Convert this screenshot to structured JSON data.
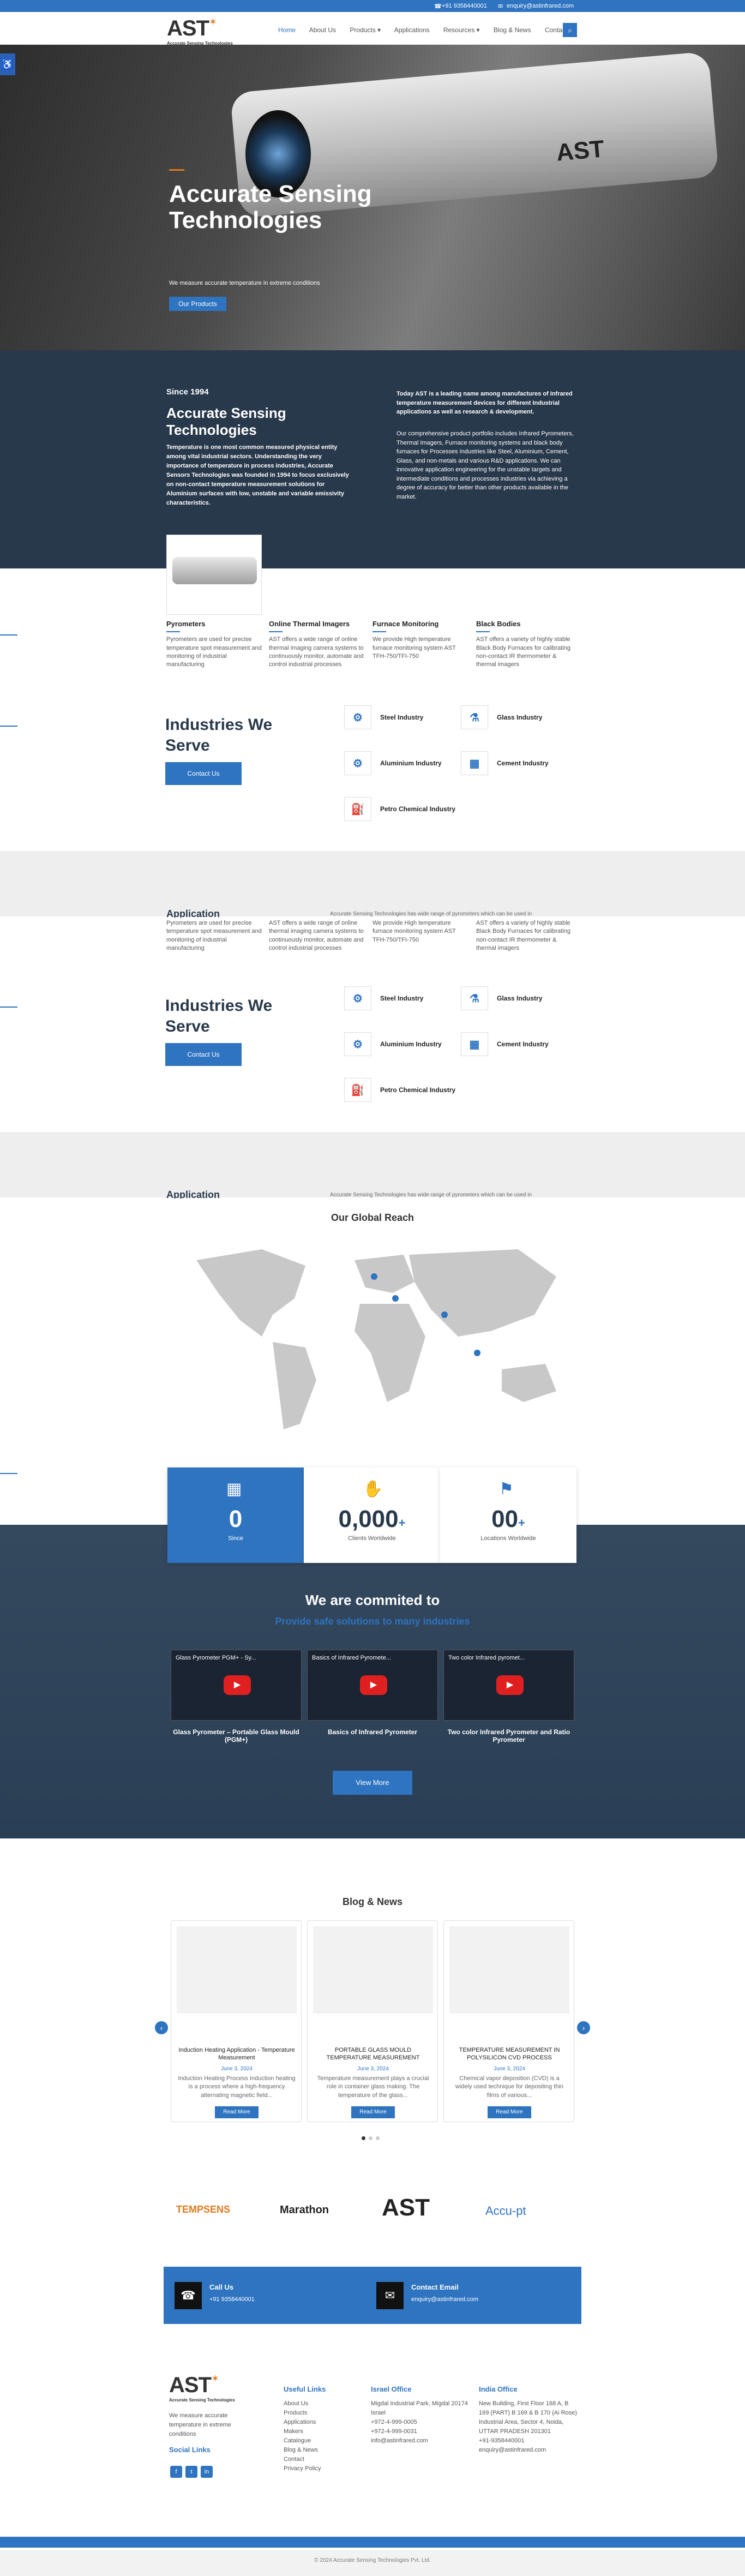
{
  "topbar": {
    "phone": "+91 9358440001",
    "email": "enquiry@astinfrared.com"
  },
  "logo": {
    "brand": "AST",
    "tagline": "Accurate Sensing Technologies"
  },
  "nav": {
    "items": [
      "Home",
      "About Us",
      "Products ▾",
      "Applications",
      "Resources ▾",
      "Blog & News",
      "Contact Us"
    ]
  },
  "hero": {
    "title": "Accurate Sensing Technologies",
    "subtitle": "We measure accurate temperature in extreme conditions",
    "cta": "Our Products",
    "camera_label": "AST"
  },
  "about": {
    "since": "Since 1994",
    "title": "Accurate Sensing Technologies",
    "text": "Temperature is one most common measured physical entity among vital industrial sectors. Understanding the very importance of temperature in process industries, Accurate Sensors Technologies was founded in 1994 to focus exclusively on non-contact temperature measurement solutions for Aluminium surfaces with low, unstable and variable emissivity characteristics.",
    "right_bold": "Today AST is a leading name among manufactures of Infrared temperature measurement devices for different Industrial applications as well as research & development.",
    "right_text": "Our comprehensive product portfolio includes Infrared Pyrometers, Thermal Imagers, Furnace monitoring systems and black body furnaces for Processes Industries like Steel, Aluminium, Cement, Glass, and non-metals and various R&D applications. We can innovative application engineering for the unstable targets and intermediate conditions and processes industries via achieving a degree of accuracy for better than other products available in the market."
  },
  "products": [
    {
      "name": "Pyrometers",
      "text": "Pyrometers are used for precise temperature spot measurement and monitoring of industrial manufacturing"
    },
    {
      "name": "Online Thermal Imagers",
      "text": "AST offers a wide range of online thermal imaging camera systems to continuously monitor, automate and control industrial processes"
    },
    {
      "name": "Furnace Monitoring",
      "text": "We provide High temperature furnace monitoring system AST TFH-750/TFI-750"
    },
    {
      "name": "Black Bodies",
      "text": "AST offers a variety of highly stable Black Body Furnaces for calibrating non-contact IR thermometer & thermal imagers"
    }
  ],
  "industries": {
    "title": "Industries We Serve",
    "cta": "Contact Us",
    "items": [
      "Steel Industry",
      "Glass Industry",
      "Aluminium Industry",
      "Cement Industry",
      "Petro Chemical Industry"
    ]
  },
  "application": {
    "title": "Application",
    "text": "Accurate Sensing Technologies has wide range of pyrometers which can be used in"
  },
  "map": {
    "title": "Our Global Reach"
  },
  "stats": [
    {
      "num": "0",
      "label": "Since"
    },
    {
      "num": "0,000",
      "suffix": "+",
      "label": "Clients Worldwide"
    },
    {
      "num": "00",
      "suffix": "+",
      "label": "Locations Worldwide"
    }
  ],
  "committed": {
    "title": "We are commited to",
    "subtitle": "Provide safe solutions to many industries",
    "cta": "View More"
  },
  "videos": [
    {
      "title": "Glass Pyrometer PGM+ - Sy...",
      "caption": "Glass Pyrometer – Portable Glass Mould (PGM+)"
    },
    {
      "title": "Basics of Infrared Pyromete...",
      "caption": "Basics of Infrared Pyrometer"
    },
    {
      "title": "Two color Infrared pyromet...",
      "caption": "Two color Infrared Pyrometer and Ratio Pyrometer"
    }
  ],
  "blog": {
    "title": "Blog & News",
    "cards": [
      {
        "title": "Induction Heating Application - Temperature Measurement",
        "date": "June 3, 2024",
        "text": "Induction Heating Process Induction heating is a process where a high-frequency alternating magnetic field...",
        "cta": "Read More"
      },
      {
        "title": "PORTABLE GLASS MOULD TEMPERATURE MEASUREMENT",
        "date": "June 3, 2024",
        "text": "Temperature measurement plays a crucial role in container glass making. The temperature of the glass...",
        "cta": "Read More"
      },
      {
        "title": "TEMPERATURE MEASUREMENT IN POLYSILICON CVD PROCESS",
        "date": "June 3, 2024",
        "text": "Chemical vapor deposition (CVD) is a widely used technique for depositing thin films of various...",
        "cta": "Read More"
      }
    ]
  },
  "partners": [
    "TEMPSENS",
    "Marathon",
    "AST",
    "Accu-pt"
  ],
  "contact": {
    "call_label": "Call Us",
    "call_value": "+91 9358440001",
    "email_label": "Contact Email",
    "email_value": "enquiry@astinfrared.com"
  },
  "footer": {
    "about": "We measure accurate temperature in extreme conditions",
    "social_title": "Social Links",
    "links_title": "Useful Links",
    "links": [
      "About Us",
      "Products",
      "Applications",
      "Makers",
      "Catalogue",
      "Blog & News",
      "Contact",
      "Privacy Policy"
    ],
    "israel_title": "Israel Office",
    "israel": "Migdal Industrial Park, Migdal 20174 Israel",
    "israel_phone": "+972-4-999-0005",
    "israel_phone2": "+972-4-999-0031",
    "israel_email": "info@astinfrared.com",
    "india_title": "India Office",
    "india": "New Building, First Floor 168 A, B 169 (PART) B 169 & B 170 (Ai Rose) Industrial Area, Sector 4, Noida, UTTAR PRADESH 201301",
    "india_phone": "+91-9358440001",
    "india_email": "enquiry@astinfrared.com",
    "copyright": "© 2024 Accurate Sensing Technologies Pvt. Ltd."
  }
}
